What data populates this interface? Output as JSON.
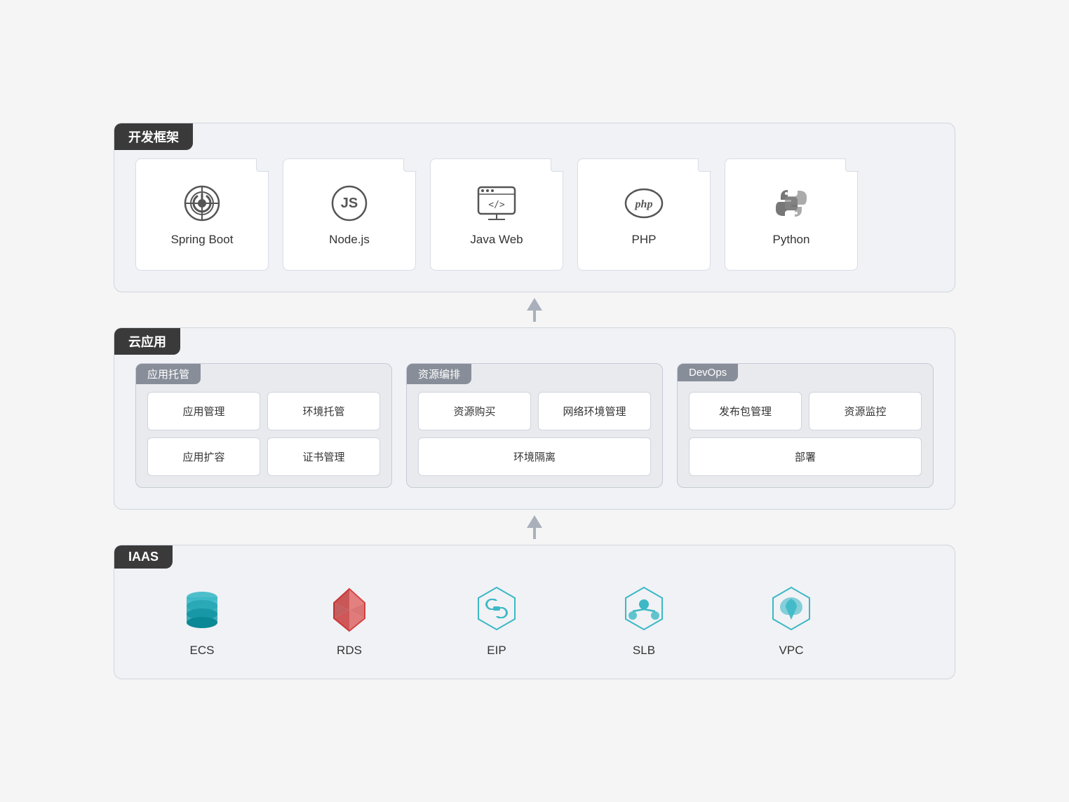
{
  "devFramework": {
    "label": "开发框架",
    "cards": [
      {
        "id": "spring-boot",
        "name": "Spring Boot",
        "icon": "springboot"
      },
      {
        "id": "nodejs",
        "name": "Node.js",
        "icon": "nodejs"
      },
      {
        "id": "java-web",
        "name": "Java Web",
        "icon": "javaweb"
      },
      {
        "id": "php",
        "name": "PHP",
        "icon": "php"
      },
      {
        "id": "python",
        "name": "Python",
        "icon": "python"
      }
    ]
  },
  "cloudApp": {
    "label": "云应用",
    "groups": [
      {
        "id": "app-hosting",
        "label": "应用托管",
        "rows": [
          [
            "应用管理",
            "环境托管"
          ],
          [
            "应用扩容",
            "证书管理"
          ]
        ]
      },
      {
        "id": "resource-scheduling",
        "label": "资源编排",
        "rows": [
          [
            "资源购买",
            "网络环境管理"
          ],
          [
            "环境隔离"
          ]
        ]
      },
      {
        "id": "devops",
        "label": "DevOps",
        "rows": [
          [
            "发布包管理",
            "资源监控"
          ],
          [
            "部署"
          ]
        ]
      }
    ]
  },
  "iaas": {
    "label": "IAAS",
    "cards": [
      {
        "id": "ecs",
        "name": "ECS",
        "icon": "ecs"
      },
      {
        "id": "rds",
        "name": "RDS",
        "icon": "rds"
      },
      {
        "id": "eip",
        "name": "EIP",
        "icon": "eip"
      },
      {
        "id": "slb",
        "name": "SLB",
        "icon": "slb"
      },
      {
        "id": "vpc",
        "name": "VPC",
        "icon": "vpc"
      }
    ]
  }
}
